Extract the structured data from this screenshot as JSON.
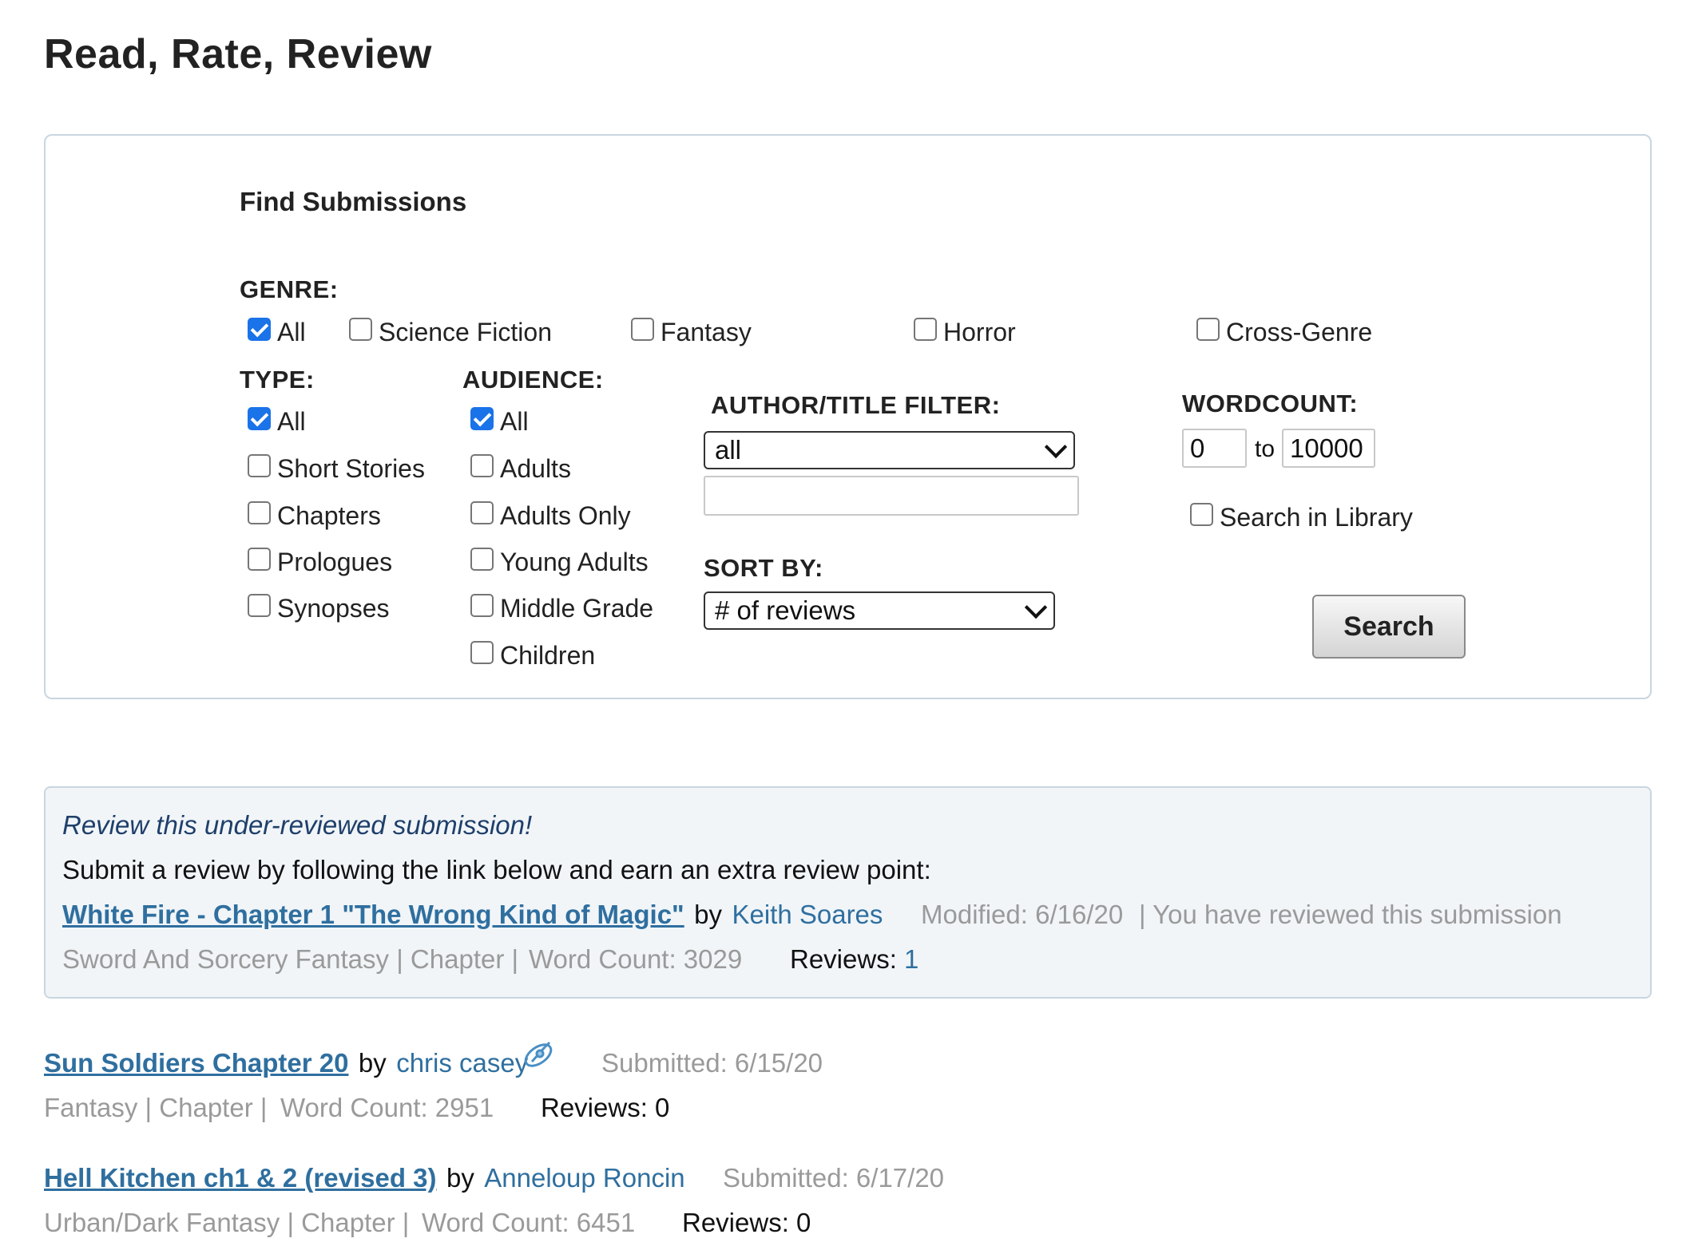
{
  "page_title": "Read, Rate, Review",
  "finder": {
    "title": "Find Submissions",
    "genre": {
      "label": "GENRE:",
      "options": [
        {
          "label": "All",
          "checked": true
        },
        {
          "label": "Science Fiction",
          "checked": false
        },
        {
          "label": "Fantasy",
          "checked": false
        },
        {
          "label": "Horror",
          "checked": false
        },
        {
          "label": "Cross-Genre",
          "checked": false
        }
      ]
    },
    "type": {
      "label": "TYPE:",
      "options": [
        {
          "label": "All",
          "checked": true
        },
        {
          "label": "Short Stories",
          "checked": false
        },
        {
          "label": "Chapters",
          "checked": false
        },
        {
          "label": "Prologues",
          "checked": false
        },
        {
          "label": "Synopses",
          "checked": false
        }
      ]
    },
    "audience": {
      "label": "AUDIENCE:",
      "options": [
        {
          "label": "All",
          "checked": true
        },
        {
          "label": "Adults",
          "checked": false
        },
        {
          "label": "Adults Only",
          "checked": false
        },
        {
          "label": "Young Adults",
          "checked": false
        },
        {
          "label": "Middle Grade",
          "checked": false
        },
        {
          "label": "Children",
          "checked": false
        }
      ]
    },
    "author_filter": {
      "label": "AUTHOR/TITLE FILTER:",
      "selected": "all",
      "text_value": ""
    },
    "sort_by": {
      "label": "SORT BY:",
      "selected": "# of reviews"
    },
    "wordcount": {
      "label": "WORDCOUNT:",
      "min": "0",
      "to_label": "to",
      "max": "10000"
    },
    "search_in_library": {
      "label": "Search in Library",
      "checked": false
    },
    "search_button": "Search"
  },
  "featured": {
    "heading": "Review this under-reviewed submission!",
    "subtext": "Submit a review by following the link below and earn an extra review point:",
    "title": "White Fire - Chapter 1 \"The Wrong Kind of Magic\"",
    "by": "by",
    "author": "Keith Soares",
    "modified": "Modified: 6/16/20",
    "reviewed_note": "| You have reviewed this submission",
    "meta": "Sword And Sorcery Fantasy | Chapter |",
    "word_count": "Word Count: 3029",
    "reviews_label": "Reviews:",
    "reviews_value": "1"
  },
  "submissions": [
    {
      "title": "Sun Soldiers Chapter 20",
      "by": "by",
      "author": "chris casey",
      "author_icon": "rocket-icon",
      "submitted": "Submitted: 6/15/20",
      "meta": "Fantasy | Chapter |",
      "word_count": "Word Count: 2951",
      "reviews": "Reviews: 0"
    },
    {
      "title": "Hell Kitchen ch1 & 2 (revised 3)",
      "by": "by",
      "author": "Anneloup Roncin",
      "submitted": "Submitted: 6/17/20",
      "meta": "Urban/Dark Fantasy | Chapter |",
      "word_count": "Word Count: 6451",
      "reviews": "Reviews: 0"
    }
  ]
}
